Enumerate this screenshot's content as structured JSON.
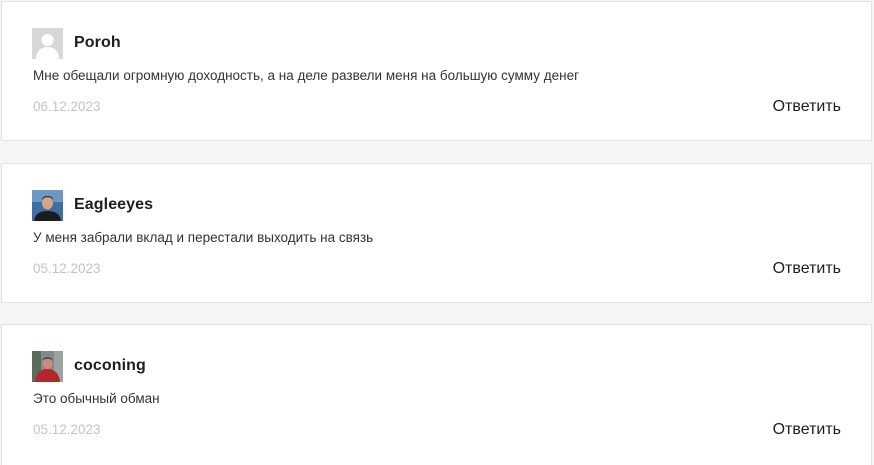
{
  "comments": [
    {
      "author": "Poroh",
      "avatar": "default-avatar-icon",
      "text": "Мне обещали огромную доходность, а на деле развели меня на большую сумму денег",
      "date": "06.12.2023",
      "reply_label": "Ответить"
    },
    {
      "author": "Eagleeyes",
      "avatar": "user-photo",
      "text": "У меня забрали вклад и перестали выходить на связь",
      "date": "05.12.2023",
      "reply_label": "Ответить"
    },
    {
      "author": "coconing",
      "avatar": "user-photo",
      "text": "Это обычный обман",
      "date": "05.12.2023",
      "reply_label": "Ответить"
    }
  ],
  "colors": {
    "page_background": "#f5f5f3",
    "card_background": "#ffffff",
    "author": "#1e1e1e",
    "text": "#333333",
    "date": "#c4c4c4"
  }
}
